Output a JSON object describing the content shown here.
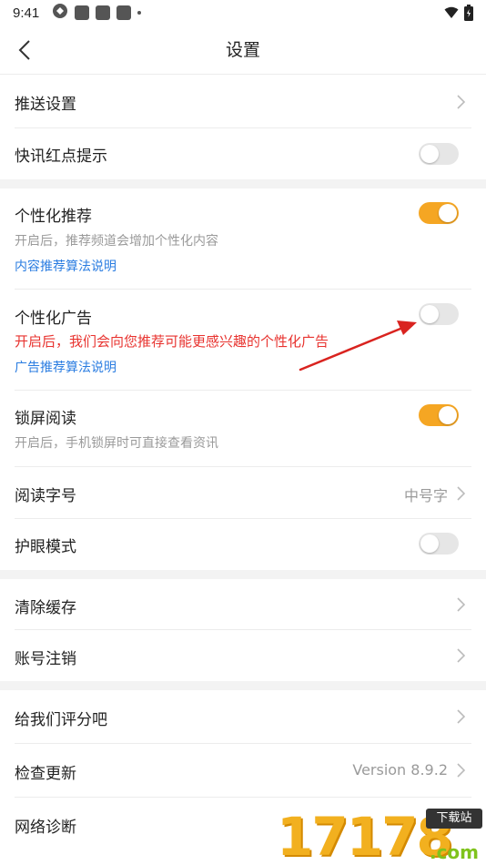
{
  "status_bar": {
    "time": "9:41",
    "icons": [
      "sync-icon",
      "app-icon",
      "app-icon",
      "app-icon",
      "dot-icon",
      "wifi-icon",
      "battery-icon"
    ]
  },
  "nav": {
    "title": "设置",
    "back_icon": "chevron-left-icon"
  },
  "rows": {
    "push_settings": {
      "label": "推送设置"
    },
    "flash_red_dot": {
      "label": "快讯红点提示",
      "enabled": false
    },
    "personal_recommend": {
      "label": "个性化推荐",
      "enabled": true,
      "desc": "开启后，推荐频道会增加个性化内容",
      "link": "内容推荐算法说明"
    },
    "personal_ads": {
      "label": "个性化广告",
      "enabled": false,
      "desc": "开启后，我们会向您推荐可能更感兴趣的个性化广告",
      "link": "广告推荐算法说明"
    },
    "lock_screen_reading": {
      "label": "锁屏阅读",
      "enabled": true,
      "desc": "开启后，手机锁屏时可直接查看资讯"
    },
    "font_size": {
      "label": "阅读字号",
      "value": "中号字"
    },
    "eye_care": {
      "label": "护眼模式",
      "enabled": false
    },
    "clear_cache": {
      "label": "清除缓存"
    },
    "cancel_account": {
      "label": "账号注销"
    },
    "rate_us": {
      "label": "给我们评分吧"
    },
    "check_update": {
      "label": "检查更新",
      "value": "Version 8.9.2"
    },
    "network_diagnose": {
      "label": "网络诊断"
    }
  },
  "colors": {
    "toggle_on": "#f5a623",
    "toggle_off": "#e6e6e6",
    "link": "#2b7de1",
    "warning_text": "#e8332f",
    "annotation_arrow": "#d9231f"
  },
  "watermark": {
    "digits": "17178",
    "badge": "下载站",
    "suffix": ".com"
  }
}
